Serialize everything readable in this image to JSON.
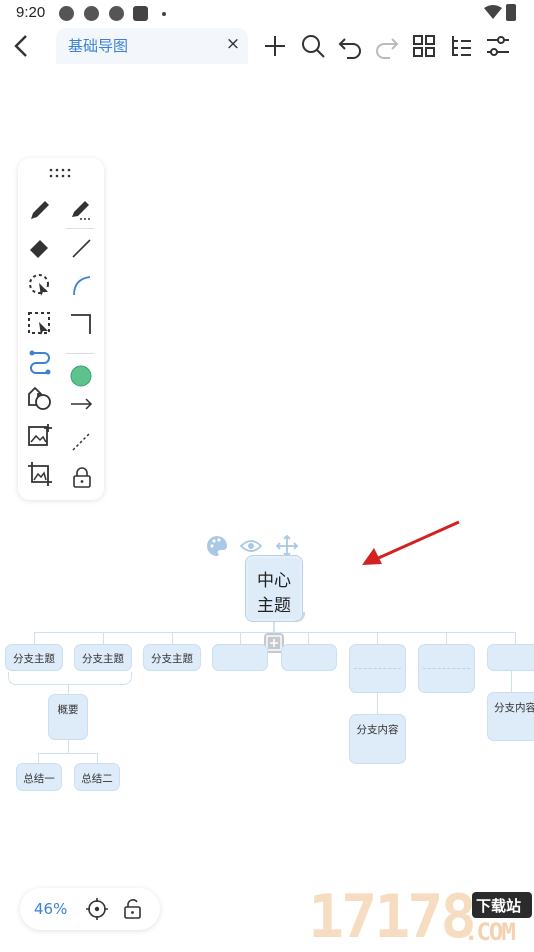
{
  "status_bar": {
    "time": "9:20"
  },
  "toolbar": {
    "tab_title": "基础导图",
    "close_label": "×"
  },
  "mindmap": {
    "center_line1": "中心",
    "center_line2": "主题",
    "branch1": "分支主题",
    "branch2": "分支主题",
    "branch3": "分支主题",
    "summary": "概要",
    "summary_child1": "总结一",
    "summary_child2": "总结二",
    "content1": "分支内容",
    "content2": "分支内容"
  },
  "bottom_bar": {
    "zoom": "46%"
  },
  "watermark": {
    "digits": "17178",
    "badge": "下载站",
    "domain": ".COM"
  },
  "colors": {
    "accent": "#3b82d6",
    "node_fill": "#deebf8",
    "arrow": "#d32121",
    "stroke_green": "#5cc28e"
  }
}
